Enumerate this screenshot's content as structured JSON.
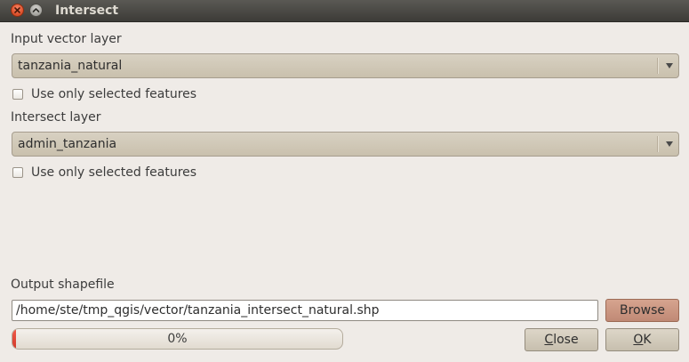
{
  "window": {
    "title": "Intersect"
  },
  "input_layer": {
    "label": "Input vector layer",
    "value": "tanzania_natural",
    "selected_only_label": "Use only selected features",
    "selected_only_checked": false
  },
  "intersect_layer": {
    "label": "Intersect layer",
    "value": "admin_tanzania",
    "selected_only_label": "Use only selected features",
    "selected_only_checked": false
  },
  "output": {
    "label": "Output shapefile",
    "value": "/home/ste/tmp_qgis/vector/tanzania_intersect_natural.shp",
    "browse_label": "Browse"
  },
  "progress": {
    "value": 0,
    "text": "0%",
    "fill_color": "#e04a3a"
  },
  "buttons": {
    "close_label": "Close",
    "close_mnemonic": "C",
    "close_rest": "lose",
    "ok_label": "OK",
    "ok_mnemonic": "O",
    "ok_rest": "K"
  },
  "icons": {
    "window_close": "close-icon",
    "window_maximize": "maximize-icon",
    "combo_arrow": "chevron-down-icon"
  },
  "colors": {
    "titlebar": "#3c3b37",
    "close_button": "#e0532e",
    "browse_button": "#c99481"
  }
}
